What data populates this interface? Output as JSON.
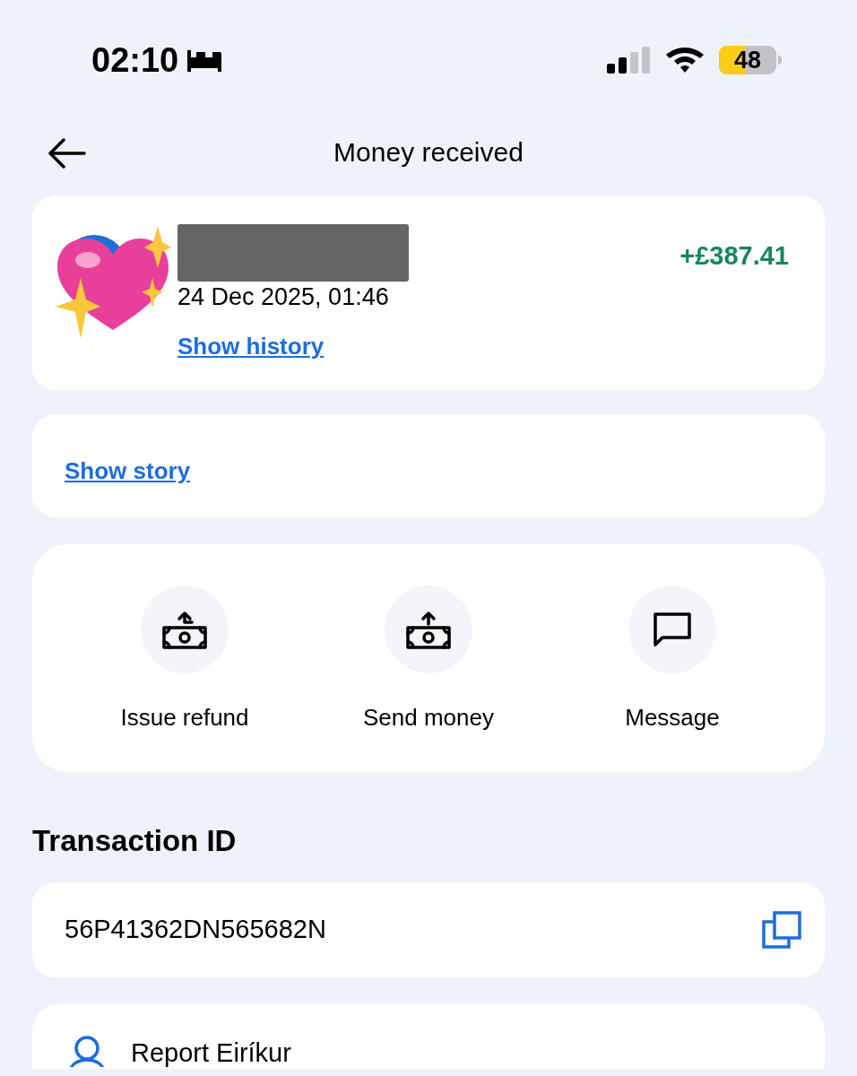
{
  "status_bar": {
    "time": "02:10",
    "battery": "48"
  },
  "header": {
    "title": "Money received"
  },
  "payment": {
    "amount": "+£387.41",
    "date": "24 Dec 2025, 01:46",
    "history_link": "Show history"
  },
  "story": {
    "link": "Show story"
  },
  "actions": [
    {
      "kind": "refund",
      "label": "Issue refund"
    },
    {
      "kind": "send",
      "label": "Send money"
    },
    {
      "kind": "message",
      "label": "Message"
    }
  ],
  "transaction": {
    "heading": "Transaction ID",
    "id": "56P41362DN565682N"
  },
  "report": {
    "label": "Report Eiríkur"
  }
}
